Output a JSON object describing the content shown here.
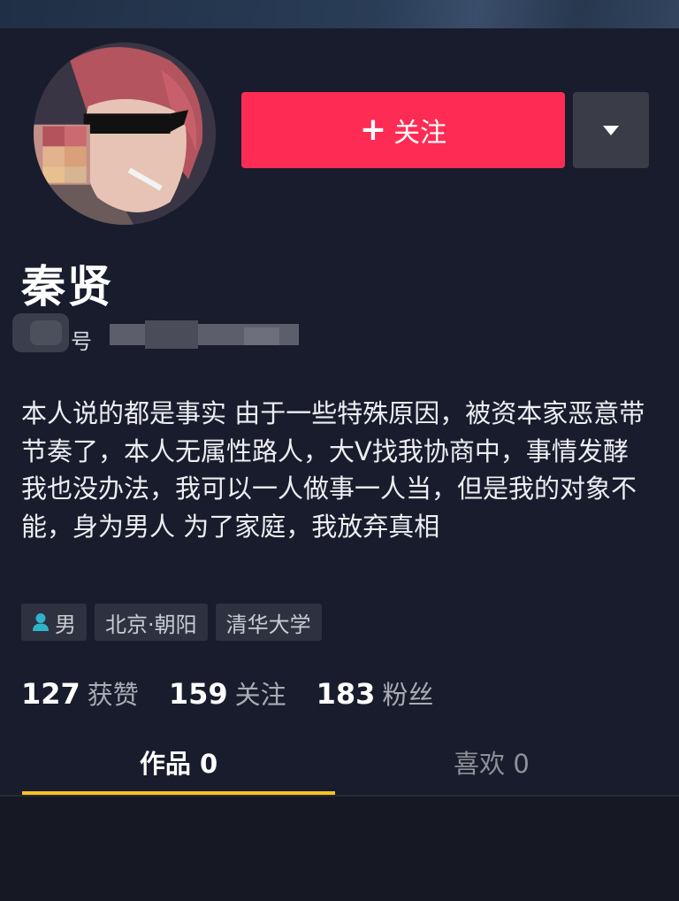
{
  "header": {
    "follow_label": "关注",
    "follow_plus": "+"
  },
  "profile": {
    "name": "秦贤",
    "account_label": "号",
    "bio": "本人说的都是事实 由于一些特殊原因，被资本家恶意带节奏了，本人无属性路人，大V找我协商中，事情发酵我也没办法，我可以一人做事一人当，但是我的对象不能，身为男人 为了家庭，我放弃真相"
  },
  "tags": {
    "gender": "男",
    "location": "北京·朝阳",
    "school": "清华大学"
  },
  "stats": {
    "likes_count": "127",
    "likes_label": "获赞",
    "following_count": "159",
    "following_label": "关注",
    "followers_count": "183",
    "followers_label": "粉丝"
  },
  "tabs": {
    "works": "作品 0",
    "likes": "喜欢 0"
  },
  "colors": {
    "accent": "#fe2c55",
    "tab_indicator": "#fcc21b",
    "gender_icon": "#2fb3c9"
  }
}
